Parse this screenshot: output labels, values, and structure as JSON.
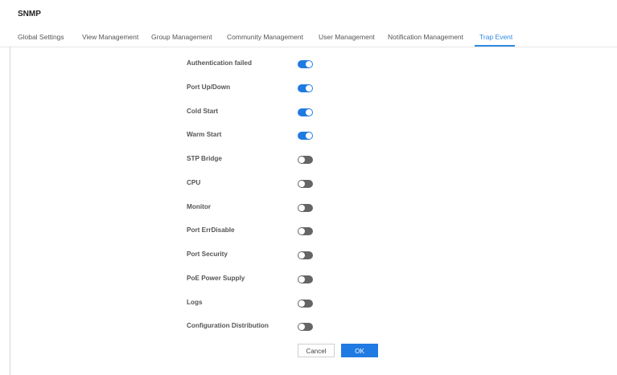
{
  "page": {
    "title": "SNMP"
  },
  "tabs": [
    {
      "label": "Global Settings",
      "active": false
    },
    {
      "label": "View Management",
      "active": false
    },
    {
      "label": "Group Management",
      "active": false
    },
    {
      "label": "Community Management",
      "active": false
    },
    {
      "label": "User Management",
      "active": false
    },
    {
      "label": "Notification Management",
      "active": false
    },
    {
      "label": "Trap Event",
      "active": true
    }
  ],
  "trap_events": [
    {
      "label": "Authentication failed",
      "enabled": true
    },
    {
      "label": "Port Up/Down",
      "enabled": true
    },
    {
      "label": "Cold Start",
      "enabled": true
    },
    {
      "label": "Warm Start",
      "enabled": true
    },
    {
      "label": "STP Bridge",
      "enabled": false
    },
    {
      "label": "CPU",
      "enabled": false
    },
    {
      "label": "Monitor",
      "enabled": false
    },
    {
      "label": "Port ErrDisable",
      "enabled": false
    },
    {
      "label": "Port Security",
      "enabled": false
    },
    {
      "label": "PoE Power Supply",
      "enabled": false
    },
    {
      "label": "Logs",
      "enabled": false
    },
    {
      "label": "Configuration Distribution",
      "enabled": false
    }
  ],
  "buttons": {
    "cancel": "Cancel",
    "ok": "OK"
  },
  "colors": {
    "accent": "#1f7be2",
    "toggle_off": "#656565",
    "tab_active": "#2f8ae4"
  }
}
